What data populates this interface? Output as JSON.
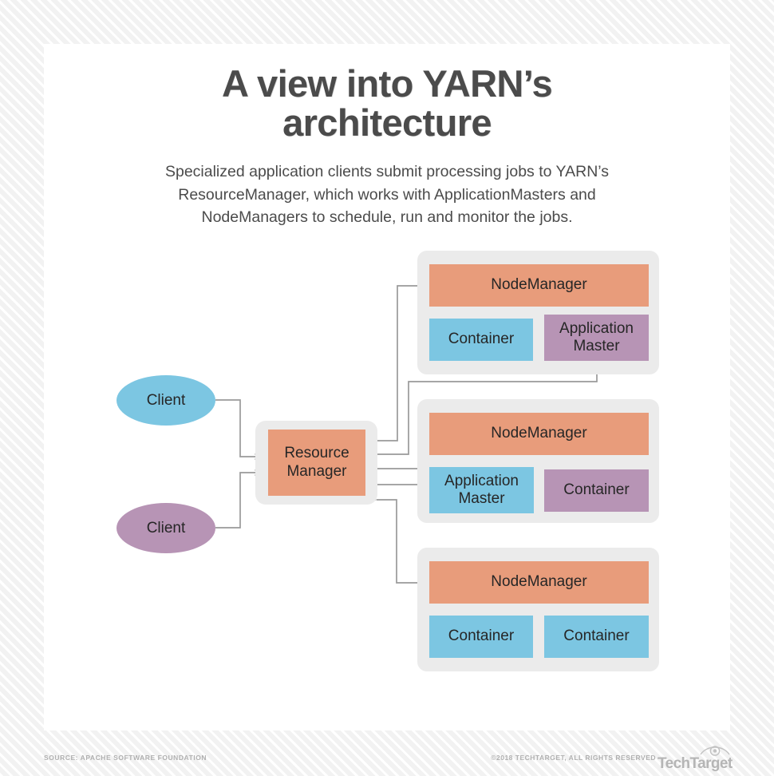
{
  "header": {
    "title": "A view into YARN’s architecture",
    "subtitle": "Specialized application clients submit processing jobs to YARN’s ResourceManager, which works with ApplicationMasters and NodeManagers to schedule, run and monitor the jobs."
  },
  "diagram": {
    "clients": [
      {
        "label": "Client",
        "color": "#7cc6e2"
      },
      {
        "label": "Client",
        "color": "#b794b5"
      }
    ],
    "resource_manager": {
      "label": "Resource\nManager",
      "line1": "Resource",
      "line2": "Manager",
      "color": "#e89c7b",
      "shell_color": "#ebebeb"
    },
    "node_groups": [
      {
        "title": "NodeManager",
        "title_color": "#e89c7b",
        "children": [
          {
            "label": "Container",
            "color": "#7cc6e2"
          },
          {
            "label": "Application\nMaster",
            "line1": "Application",
            "line2": "Master",
            "color": "#b794b5"
          }
        ]
      },
      {
        "title": "NodeManager",
        "title_color": "#e89c7b",
        "children": [
          {
            "label": "Application\nMaster",
            "line1": "Application",
            "line2": "Master",
            "color": "#7cc6e2"
          },
          {
            "label": "Container",
            "color": "#b794b5"
          }
        ]
      },
      {
        "title": "NodeManager",
        "title_color": "#e89c7b",
        "children": [
          {
            "label": "Container",
            "color": "#7cc6e2"
          },
          {
            "label": "Container",
            "color": "#7cc6e2"
          }
        ]
      }
    ],
    "connector_color": "#9a9a9a"
  },
  "footer": {
    "source": "SOURCE: APACHE SOFTWARE FOUNDATION",
    "copyright": "©2018 TECHTARGET, ALL RIGHTS RESERVED",
    "logo_text": "TechTarget",
    "logo_icon": "eye-icon"
  },
  "colors": {
    "orange": "#e89c7b",
    "blue": "#7cc6e2",
    "purple": "#b794b5",
    "group_gray": "#ebebeb",
    "text_dark": "#4b4b4b",
    "connector": "#9a9a9a"
  }
}
